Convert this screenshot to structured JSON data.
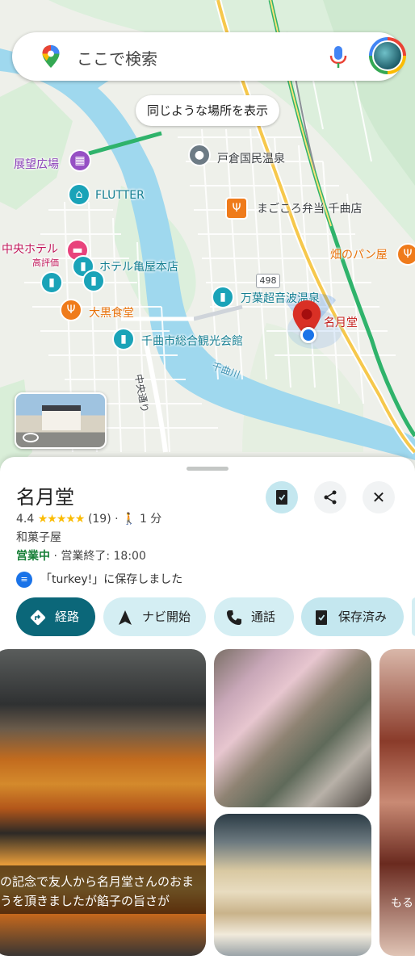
{
  "search": {
    "placeholder": "ここで検索"
  },
  "map": {
    "chip_label": "同じような場所を表示",
    "road_badge": "498",
    "labels": {
      "observatory": "展望広場",
      "flutter": "FLUTTER",
      "togura_onsen": "戸倉国民温泉",
      "magokoro": "まごころ弁当 千曲店",
      "chuo_hotel": "中央ホテル",
      "chuo_hotel_sub": "高評価",
      "kameya": "ホテル亀屋本店",
      "hatake_pan": "畑のパン屋",
      "manyo": "万葉超音波温泉",
      "meigetsudo": "名月堂",
      "daikoku": "大黒食堂",
      "chikuma_kanko": "千曲市総合観光会館",
      "chuo_dori": "中央通り",
      "chikuma_river": "千曲川"
    }
  },
  "place": {
    "name": "名月堂",
    "rating": "4.4",
    "stars": "★★★★★",
    "review_count": "(19)",
    "separator": "·",
    "walk_time": "1 分",
    "category": "和菓子屋",
    "open_status": "営業中",
    "hours_detail": " · 営業終了: 18:00",
    "saved_text": "「turkey!」に保存しました"
  },
  "actions": {
    "directions": "経路",
    "start_navi": "ナビ開始",
    "call": "通話",
    "saved": "保存済み"
  },
  "photos": {
    "caption_line1": "の記念で友人から名月堂さんのおま",
    "caption_line2": "うを頂きましたが餡子の旨さが",
    "right_caption": "もる"
  },
  "colors": {
    "accent_teal": "#0b6779",
    "chip_bg": "#d4eef3",
    "open_green": "#188038",
    "pin_red": "#d93025",
    "location_blue": "#1a73e8",
    "star_yellow": "#fbbc04",
    "river_blue": "#9fd8ee",
    "poi_blue": "#1aa3b8",
    "poi_orange": "#ef7b1b",
    "poi_pink": "#e8437c",
    "poi_purple": "#9650c4"
  }
}
